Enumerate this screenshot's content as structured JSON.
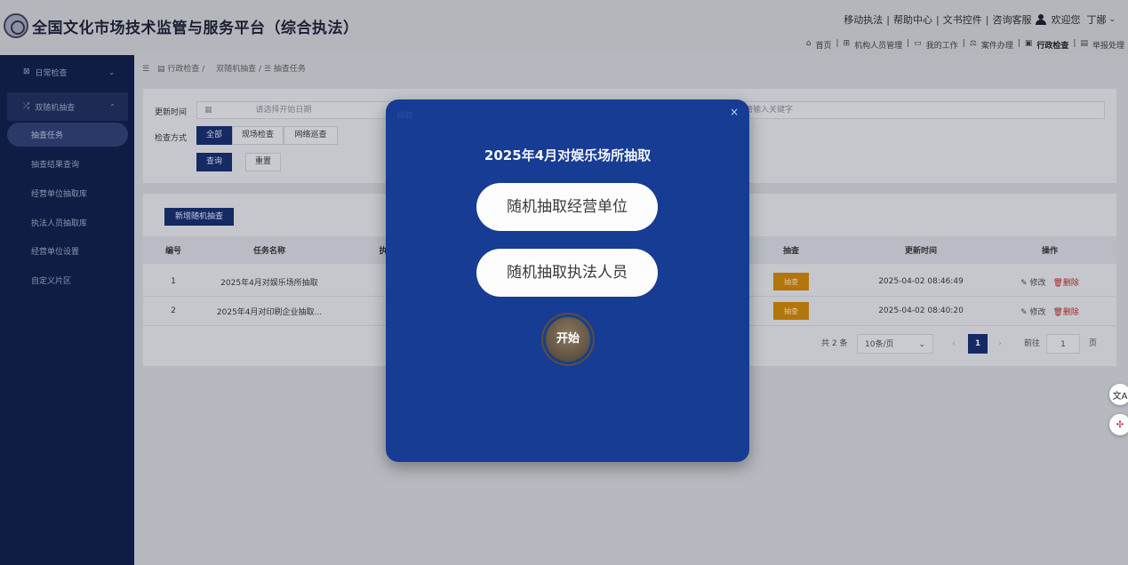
{
  "header": {
    "title": "全国文化市场技术监管与服务平台（综合执法）",
    "top_links": [
      "移动执法",
      "帮助中心",
      "文书控件",
      "咨询客服"
    ],
    "welcome": "欢迎您",
    "user_name": "丁娜",
    "nav": [
      "首页",
      "机构人员管理",
      "我的工作",
      "案件办理",
      "行政检查",
      "举报处理"
    ]
  },
  "sidebar": {
    "group_daily": "日常检查",
    "group_random": "双随机抽查",
    "items": [
      "抽查任务",
      "抽查结果查询",
      "经营单位抽取库",
      "执法人员抽取库",
      "经营单位设置",
      "自定义片区"
    ]
  },
  "breadcrumb": {
    "level1": "行政检查",
    "level2": "双随机抽查",
    "level3": "抽查任务"
  },
  "filter": {
    "update_time_label": "更新时间",
    "date_placeholder": "请选择开始日期",
    "keyword_placeholder": "请输入关键字",
    "method_label": "检查方式",
    "methods": [
      "全部",
      "现场检查",
      "网络巡查"
    ],
    "query": "查询",
    "reset": "重置"
  },
  "table": {
    "add_button": "新增随机抽查",
    "headers": {
      "no": "编号",
      "name": "任务名称",
      "exec": "执",
      "draw": "抽查",
      "updated": "更新时间",
      "ops": "操作"
    },
    "rows": [
      {
        "no": "1",
        "name": "2025年4月对娱乐场所抽取",
        "draw": "抽查",
        "updated": "2025-04-02 08:46:49",
        "edit": "修改",
        "delete": "删除"
      },
      {
        "no": "2",
        "name": "2025年4月对印刷企业抽取...",
        "draw": "抽查",
        "updated": "2025-04-02 08:40:20",
        "edit": "修改",
        "delete": "删除"
      }
    ]
  },
  "pagination": {
    "total": "共 2 条",
    "page_size": "10条/页",
    "current_page": "1",
    "goto_label": "前往",
    "goto_value": "1",
    "page_suffix": "页"
  },
  "modal": {
    "hint": "抽取",
    "title": "2025年4月对娱乐场所抽取",
    "option_units": "随机抽取经营单位",
    "option_officers": "随机抽取执法人员",
    "start": "开始"
  },
  "float_buttons": [
    "translate-icon",
    "network-icon"
  ]
}
